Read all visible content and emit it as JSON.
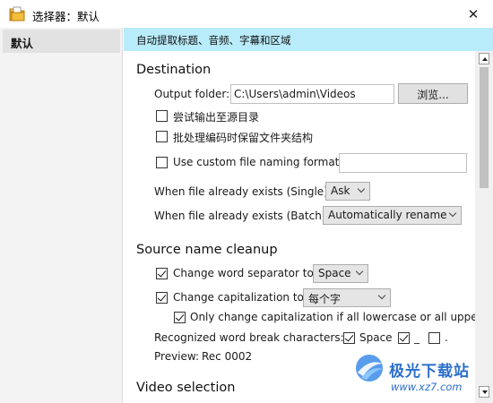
{
  "window": {
    "title": "选择器：默认",
    "close_glyph": "✕"
  },
  "sidebar": {
    "items": [
      {
        "label": "默认"
      }
    ]
  },
  "banner": {
    "text": "自动提取标题、音频、字幕和区域"
  },
  "destination": {
    "title": "Destination",
    "output_folder_label": "Output folder:",
    "output_folder_value": "C:\\Users\\admin\\Videos",
    "browse_label": "浏览...",
    "try_source_label": "尝试输出至源目录",
    "preserve_folder_label": "批处理编码时保留文件夹结构",
    "custom_naming_label": "Use custom file naming format:",
    "custom_naming_value": "",
    "exists_single_label": "When file already exists (Single):",
    "exists_single_value": "Ask",
    "exists_batch_label": "When file already exists (Batch):",
    "exists_batch_value": "Automatically rename"
  },
  "cleanup": {
    "title": "Source name cleanup",
    "word_sep_label": "Change word separator to",
    "word_sep_value": "Space",
    "capitalization_label": "Change capitalization to",
    "capitalization_value": "每个字",
    "only_lowercase_label": "Only change capitalization if all lowercase or all upper",
    "break_chars_label": "Recognized word break characters:",
    "break_space_label": "Space",
    "break_underscore_label": "_",
    "break_dot_label": ".",
    "preview_label": "Preview:",
    "preview_value": "Rec 0002"
  },
  "video": {
    "title": "Video selection"
  },
  "checkbox_states": {
    "try_source": false,
    "preserve_folder": false,
    "custom_naming": false,
    "word_sep": true,
    "capitalization": true,
    "only_lowercase": true,
    "break_space": true,
    "break_underscore": true,
    "break_dot": false
  },
  "watermark": {
    "name": "极光下载站",
    "url": "www.xz7.com"
  },
  "colors": {
    "banner": "#b8ecfb",
    "sidebar": "#f3f3f3",
    "selected_item": "#e2e2e2",
    "watermark": "#2c6fcc"
  },
  "icons": {
    "app": "folder-icon",
    "close": "close-icon",
    "dropdown": "chevron-down-icon"
  }
}
